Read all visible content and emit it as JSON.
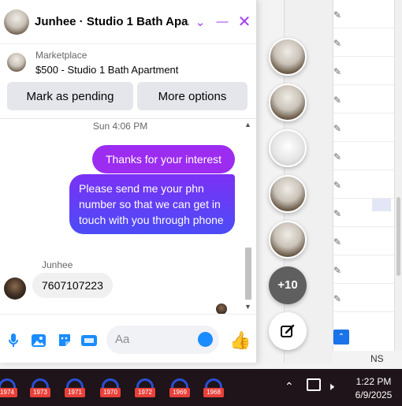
{
  "chat": {
    "title": "Junhee · Studio 1 Bath Apa...",
    "listing": {
      "source": "Marketplace",
      "title": "$500 - Studio 1 Bath Apartment",
      "mark_pending_label": "Mark as pending",
      "more_options_label": "More options"
    },
    "timestamp": "Sun 4:06 PM",
    "messages_out": [
      "Thanks for your interest",
      "Please send me your phn number so that we can get in touch with you through phone"
    ],
    "sender_name": "Junhee",
    "message_in": "7607107223",
    "composer_placeholder": "Aa"
  },
  "chat_heads": {
    "more_count": "+10"
  },
  "background": {
    "ns_label": "NS"
  },
  "taskbar": {
    "items": [
      "1974",
      "1973",
      "1971",
      "1970",
      "1972",
      "1969",
      "1968"
    ],
    "time": "1:22 PM",
    "date": "6/9/2025"
  },
  "colors": {
    "messenger_purple": "#9b2cf0",
    "messenger_blue": "#1a8cff",
    "bubble_gradient_end": "#4c4cf6"
  }
}
